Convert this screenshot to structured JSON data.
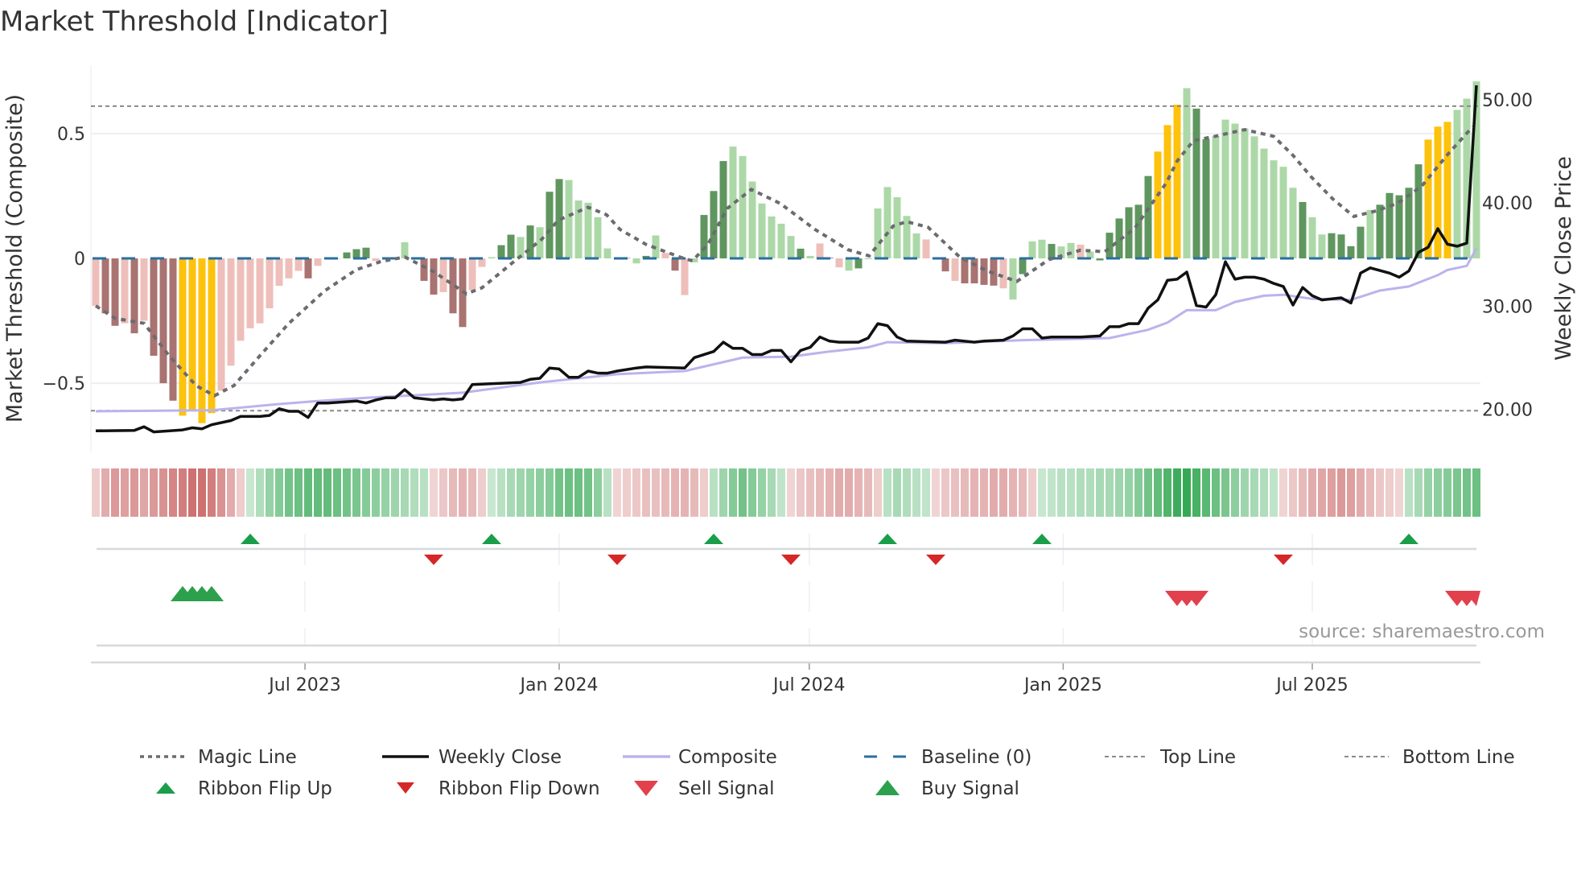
{
  "title": "Market Threshold [Indicator]",
  "source": "source: sharemaestro.com",
  "colors": {
    "bar_dark_green": "#5f965f",
    "bar_light_green": "#acd8a7",
    "bar_dark_red": "#a87370",
    "bar_light_red": "#eebfba",
    "bar_extreme": "#fdc20c",
    "magic_line": "#6b6b70",
    "weekly_close": "#111111",
    "composite": "#bbb3ec",
    "baseline": "#2a6f9f",
    "threshold_lines": "#8a8a8a",
    "ribbon_red": "#c65a5a",
    "ribbon_green": "#34a853",
    "flip_up": "#1a9e4a",
    "flip_down": "#d62728",
    "sell": "#e2404c",
    "buy": "#2ca04c"
  },
  "chart_data": {
    "type": "bar",
    "title": "Market Threshold [Indicator]",
    "x_unit": "week index (weekly bars)",
    "weeks": 144,
    "ylabel_left": "Market Threshold (Composite)",
    "ylabel_right": "Weekly Close Price",
    "ylim_left": [
      -0.777,
      0.774
    ],
    "ylim_right": [
      15.82,
      53.35
    ],
    "left_ticks": [
      {
        "v": 0.5,
        "label": "0.5"
      },
      {
        "v": 0,
        "label": "0"
      },
      {
        "v": -0.5,
        "label": "−0.5"
      }
    ],
    "right_ticks": [
      {
        "v": 50,
        "label": "50.00"
      },
      {
        "v": 40,
        "label": "40.00"
      },
      {
        "v": 30,
        "label": "30.00"
      },
      {
        "v": 20,
        "label": "20.00"
      }
    ],
    "x_ticks": [
      {
        "week": 22.67,
        "label": "Jul 2023"
      },
      {
        "week": 49,
        "label": "Jan 2024"
      },
      {
        "week": 74.9,
        "label": "Jul 2024"
      },
      {
        "week": 101.2,
        "label": "Jan 2025"
      },
      {
        "week": 127,
        "label": "Jul 2025"
      }
    ],
    "top_line": 0.61,
    "bottom_line": -0.61,
    "baseline": 0,
    "composite_bars": [
      -0.19,
      -0.22,
      -0.27,
      -0.26,
      -0.3,
      -0.25,
      -0.39,
      -0.5,
      -0.57,
      -0.63,
      -0.61,
      -0.66,
      -0.62,
      -0.53,
      -0.43,
      -0.33,
      -0.28,
      -0.26,
      -0.2,
      -0.11,
      -0.08,
      -0.05,
      -0.08,
      -0.03,
      0,
      0,
      0.024,
      0.037,
      0.043,
      -0.01,
      0,
      0,
      0.065,
      0.003,
      -0.09,
      -0.145,
      -0.135,
      -0.22,
      -0.275,
      -0.127,
      -0.034,
      0.005,
      0.053,
      0.095,
      0.086,
      0.132,
      0.125,
      0.267,
      0.318,
      0.314,
      0.232,
      0.223,
      0.165,
      0.04,
      0,
      0.002,
      -0.02,
      0.01,
      0.092,
      0.022,
      -0.049,
      -0.147,
      -0.016,
      0.174,
      0.27,
      0.39,
      0.448,
      0.41,
      0.308,
      0.22,
      0.168,
      0.139,
      0.09,
      0.039,
      0.01,
      0.06,
      0.003,
      -0.036,
      -0.049,
      -0.04,
      0,
      0.2,
      0.286,
      0.245,
      0.17,
      0.1,
      0.076,
      0,
      -0.052,
      -0.09,
      -0.1,
      -0.1,
      -0.106,
      -0.109,
      -0.12,
      -0.165,
      -0.063,
      0.068,
      0.075,
      0.058,
      0.048,
      0.062,
      0.055,
      0.027,
      -0.008,
      0.103,
      0.16,
      0.205,
      0.215,
      0.33,
      0.428,
      0.534,
      0.616,
      0.682,
      0.6,
      0.478,
      0.49,
      0.556,
      0.54,
      0.52,
      0.489,
      0.44,
      0.393,
      0.367,
      0.283,
      0.226,
      0.165,
      0.096,
      0.101,
      0.096,
      0.049,
      0.127,
      0.194,
      0.215,
      0.262,
      0.253,
      0.283,
      0.377,
      0.476,
      0.528,
      0.547,
      0.595,
      0.64,
      0.709
    ],
    "bar_shades": "rRRrRrRRRYYYYrrrrrrrrrRrggGGGrgggg RRrRRrrgGGgGgGGggggggRgGgrRrgGGGgggggggGgrRrgGGgggggrRRrRRRRrgGggGggrgGGGGGGYYYgGGgggggggggGggGGGGgGGGGGYYY",
    "magic_line": [
      [
        1,
        -0.19
      ],
      [
        3,
        -0.24
      ],
      [
        6,
        -0.26
      ],
      [
        8.6,
        -0.39
      ],
      [
        11.4,
        -0.51
      ],
      [
        13.3,
        -0.55
      ],
      [
        15.3,
        -0.51
      ],
      [
        18,
        -0.39
      ],
      [
        21,
        -0.26
      ],
      [
        24.7,
        -0.13
      ],
      [
        28,
        -0.045
      ],
      [
        30.5,
        -0.013
      ],
      [
        33,
        0.006
      ],
      [
        36,
        -0.053
      ],
      [
        39.4,
        -0.142
      ],
      [
        41,
        -0.118
      ],
      [
        44.4,
        -0.01
      ],
      [
        47.2,
        0.077
      ],
      [
        48.9,
        0.153
      ],
      [
        52,
        0.205
      ],
      [
        53.9,
        0.175
      ],
      [
        55.3,
        0.116
      ],
      [
        58,
        0.056
      ],
      [
        61.6,
        0.004
      ],
      [
        62.8,
        -0.01
      ],
      [
        64.4,
        0.056
      ],
      [
        66.4,
        0.2
      ],
      [
        68.9,
        0.276
      ],
      [
        71.9,
        0.22
      ],
      [
        75.5,
        0.116
      ],
      [
        78.9,
        0.035
      ],
      [
        81.1,
        0.01
      ],
      [
        83.6,
        0.13
      ],
      [
        85,
        0.147
      ],
      [
        87.2,
        0.125
      ],
      [
        90.5,
        0.005
      ],
      [
        93.3,
        -0.05
      ],
      [
        96.4,
        -0.092
      ],
      [
        99.7,
        -0.005
      ],
      [
        103,
        0.033
      ],
      [
        105.5,
        0.027
      ],
      [
        108.6,
        0.12
      ],
      [
        111.9,
        0.304
      ],
      [
        113,
        0.39
      ],
      [
        114.7,
        0.472
      ],
      [
        116.9,
        0.489
      ],
      [
        120,
        0.516
      ],
      [
        123,
        0.489
      ],
      [
        125,
        0.413
      ],
      [
        126.9,
        0.326
      ],
      [
        129.1,
        0.239
      ],
      [
        131.3,
        0.168
      ],
      [
        133.6,
        0.19
      ],
      [
        135.8,
        0.22
      ],
      [
        138.3,
        0.288
      ],
      [
        141.1,
        0.42
      ],
      [
        143.6,
        0.527
      ]
    ],
    "weekly_close": [
      [
        1,
        17.9
      ],
      [
        5,
        17.95
      ],
      [
        6,
        18.3
      ],
      [
        7,
        17.8
      ],
      [
        10,
        18.0
      ],
      [
        11,
        18.2
      ],
      [
        12,
        18.1
      ],
      [
        13,
        18.5
      ],
      [
        15,
        18.9
      ],
      [
        16,
        19.3
      ],
      [
        18,
        19.3
      ],
      [
        19,
        19.4
      ],
      [
        20,
        20.05
      ],
      [
        21,
        19.8
      ],
      [
        22,
        19.8
      ],
      [
        23,
        19.2
      ],
      [
        24,
        20.6
      ],
      [
        25,
        20.6
      ],
      [
        28,
        20.8
      ],
      [
        29,
        20.6
      ],
      [
        30,
        20.9
      ],
      [
        31,
        21.1
      ],
      [
        32,
        21.1
      ],
      [
        33,
        21.9
      ],
      [
        34,
        21.1
      ],
      [
        36,
        20.9
      ],
      [
        37,
        21.0
      ],
      [
        38,
        20.9
      ],
      [
        39,
        21.0
      ],
      [
        40,
        22.4
      ],
      [
        45,
        22.6
      ],
      [
        46,
        22.9
      ],
      [
        47,
        23.0
      ],
      [
        48,
        24.0
      ],
      [
        49,
        23.9
      ],
      [
        50,
        23.1
      ],
      [
        51,
        23.1
      ],
      [
        52,
        23.7
      ],
      [
        53,
        23.5
      ],
      [
        54,
        23.5
      ],
      [
        55,
        23.7
      ],
      [
        57,
        24.0
      ],
      [
        58,
        24.1
      ],
      [
        62,
        24.0
      ],
      [
        63,
        25.0
      ],
      [
        65,
        25.6
      ],
      [
        66,
        26.5
      ],
      [
        67,
        25.9
      ],
      [
        68,
        25.9
      ],
      [
        69,
        25.3
      ],
      [
        70,
        25.3
      ],
      [
        71,
        25.7
      ],
      [
        72,
        25.7
      ],
      [
        73,
        24.6
      ],
      [
        74,
        25.7
      ],
      [
        75,
        26.0
      ],
      [
        76,
        27.0
      ],
      [
        77,
        26.6
      ],
      [
        78,
        26.5
      ],
      [
        80,
        26.5
      ],
      [
        81,
        26.9
      ],
      [
        82,
        28.3
      ],
      [
        83,
        28.1
      ],
      [
        84,
        27.0
      ],
      [
        85,
        26.6
      ],
      [
        89,
        26.5
      ],
      [
        90,
        26.7
      ],
      [
        92,
        26.5
      ],
      [
        93,
        26.6
      ],
      [
        95,
        26.7
      ],
      [
        96,
        27.1
      ],
      [
        97,
        27.8
      ],
      [
        98,
        27.8
      ],
      [
        99,
        26.9
      ],
      [
        100,
        27.0
      ],
      [
        103,
        27.0
      ],
      [
        105,
        27.1
      ],
      [
        106,
        28.0
      ],
      [
        107,
        28.0
      ],
      [
        108,
        28.3
      ],
      [
        109,
        28.3
      ],
      [
        110,
        29.8
      ],
      [
        111,
        30.6
      ],
      [
        112,
        32.5
      ],
      [
        113,
        32.6
      ],
      [
        114,
        33.3
      ],
      [
        115,
        30.05
      ],
      [
        116,
        29.9
      ],
      [
        117,
        31.1
      ],
      [
        118,
        34.3
      ],
      [
        119,
        32.6
      ],
      [
        120,
        32.8
      ],
      [
        121,
        32.8
      ],
      [
        122,
        32.6
      ],
      [
        123,
        32.2
      ],
      [
        124,
        31.9
      ],
      [
        125,
        30.1
      ],
      [
        126,
        31.8
      ],
      [
        127,
        31.0
      ],
      [
        128,
        30.6
      ],
      [
        130,
        30.8
      ],
      [
        131,
        30.3
      ],
      [
        132,
        33.2
      ],
      [
        133,
        33.7
      ],
      [
        135,
        33.2
      ],
      [
        136,
        32.8
      ],
      [
        137,
        33.4
      ],
      [
        138,
        35.2
      ],
      [
        139,
        35.7
      ],
      [
        140,
        37.5
      ],
      [
        141,
        36.0
      ],
      [
        142,
        35.8
      ],
      [
        143,
        36.1
      ],
      [
        144,
        51.4
      ]
    ],
    "composite_line": [
      [
        1,
        19.8
      ],
      [
        13,
        19.9
      ],
      [
        20,
        20.5
      ],
      [
        24,
        20.8
      ],
      [
        29,
        21.1
      ],
      [
        39,
        21.6
      ],
      [
        47,
        22.6
      ],
      [
        55,
        23.4
      ],
      [
        62,
        23.7
      ],
      [
        68,
        25.0
      ],
      [
        73,
        25.1
      ],
      [
        77,
        25.6
      ],
      [
        81,
        26.0
      ],
      [
        83,
        26.5
      ],
      [
        89,
        26.4
      ],
      [
        97,
        26.7
      ],
      [
        106,
        26.9
      ],
      [
        110,
        27.7
      ],
      [
        112,
        28.4
      ],
      [
        114,
        29.6
      ],
      [
        117,
        29.6
      ],
      [
        119,
        30.4
      ],
      [
        122,
        31.0
      ],
      [
        124,
        31.1
      ],
      [
        127,
        30.7
      ],
      [
        131,
        30.6
      ],
      [
        134,
        31.5
      ],
      [
        137,
        31.9
      ],
      [
        140,
        33.0
      ],
      [
        141,
        33.5
      ],
      [
        143,
        33.9
      ],
      [
        144,
        35.6
      ]
    ],
    "ribbon": [
      -0.15,
      -0.4,
      -0.55,
      -0.5,
      -0.55,
      -0.45,
      -0.55,
      -0.6,
      -0.7,
      -0.75,
      -0.85,
      -0.85,
      -0.75,
      -0.6,
      -0.4,
      -0.15,
      0.1,
      0.25,
      0.4,
      0.5,
      0.6,
      0.65,
      0.7,
      0.7,
      0.7,
      0.65,
      0.6,
      0.55,
      0.5,
      0.45,
      0.4,
      0.35,
      0.3,
      0.25,
      0.2,
      -0.1,
      -0.2,
      -0.3,
      -0.35,
      -0.3,
      -0.15,
      0.1,
      0.2,
      0.3,
      0.35,
      0.4,
      0.45,
      0.5,
      0.6,
      0.65,
      0.65,
      0.6,
      0.45,
      0.2,
      -0.1,
      -0.15,
      -0.2,
      -0.25,
      -0.25,
      -0.3,
      -0.35,
      -0.35,
      -0.3,
      -0.15,
      0.2,
      0.35,
      0.5,
      0.6,
      0.5,
      0.4,
      0.3,
      0.15,
      -0.1,
      -0.2,
      -0.25,
      -0.3,
      -0.35,
      -0.4,
      -0.4,
      -0.35,
      -0.3,
      -0.15,
      0.2,
      0.3,
      0.25,
      0.2,
      0.15,
      -0.1,
      -0.2,
      -0.25,
      -0.3,
      -0.35,
      -0.35,
      -0.4,
      -0.4,
      -0.35,
      -0.3,
      -0.15,
      0.1,
      0.15,
      0.2,
      0.2,
      0.25,
      0.25,
      0.3,
      0.3,
      0.35,
      0.4,
      0.5,
      0.6,
      0.7,
      0.8,
      0.9,
      0.95,
      0.85,
      0.75,
      0.65,
      0.55,
      0.45,
      0.35,
      0.3,
      0.25,
      0.15,
      -0.1,
      -0.2,
      -0.3,
      -0.4,
      -0.45,
      -0.5,
      -0.55,
      -0.5,
      -0.4,
      -0.3,
      -0.2,
      -0.15,
      -0.1,
      0.2,
      0.3,
      0.4,
      0.45,
      0.5,
      0.55,
      0.6,
      0.65
    ],
    "ribbon_flip_up": [
      17,
      42,
      65,
      83,
      99,
      137
    ],
    "ribbon_flip_down": [
      36,
      55,
      73,
      88,
      124
    ],
    "buy_signal": [
      10,
      11,
      12,
      13
    ],
    "sell_signal": [
      113,
      114,
      115,
      142,
      143,
      144
    ],
    "legend": {
      "magic_line": "Magic Line",
      "weekly_close": "Weekly Close",
      "composite": "Composite",
      "baseline": "Baseline (0)",
      "top_line": "Top Line",
      "bottom_line": "Bottom Line",
      "flip_up": "Ribbon Flip Up",
      "flip_down": "Ribbon Flip Down",
      "sell": "Sell Signal",
      "buy": "Buy Signal"
    },
    "legend_placement": "bottom"
  }
}
